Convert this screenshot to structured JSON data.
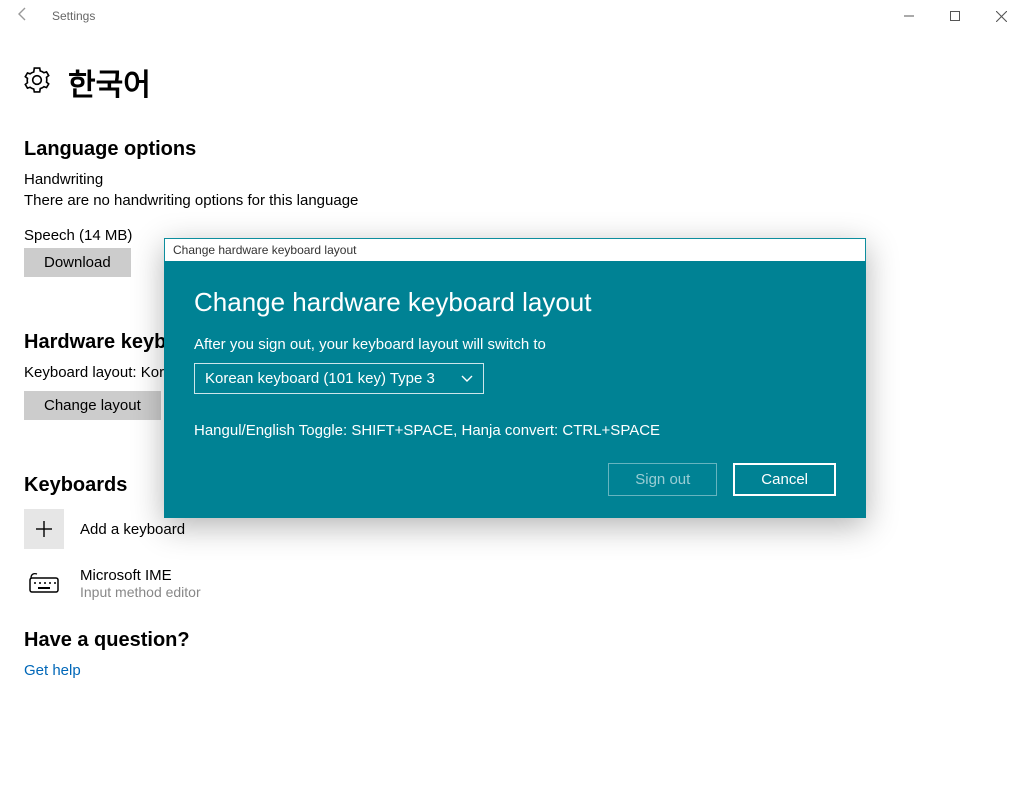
{
  "window": {
    "title": "Settings"
  },
  "page": {
    "title": "한국어"
  },
  "sections": {
    "languageOptions": {
      "heading": "Language options",
      "handwriting_label": "Handwriting",
      "handwriting_desc": "There are no handwriting options for this language",
      "speech_label": "Speech (14 MB)",
      "download_label": "Download"
    },
    "hardware": {
      "heading": "Hardware keyboard layout",
      "layout_label": "Keyboard layout:  Korean keyboard (101 key) Type 1",
      "change_label": "Change layout"
    },
    "keyboards": {
      "heading": "Keyboards",
      "add_label": "Add a keyboard",
      "ime_name": "Microsoft IME",
      "ime_sub": "Input method editor"
    },
    "help": {
      "heading": "Have a question?",
      "link": "Get help"
    }
  },
  "dialog": {
    "frame_title": "Change hardware keyboard layout",
    "heading": "Change hardware keyboard layout",
    "intro": "After you sign out, your keyboard layout will switch to",
    "selected": "Korean keyboard (101 key) Type 3",
    "hint": "Hangul/English Toggle: SHIFT+SPACE, Hanja convert: CTRL+SPACE",
    "signout": "Sign out",
    "cancel": "Cancel"
  }
}
